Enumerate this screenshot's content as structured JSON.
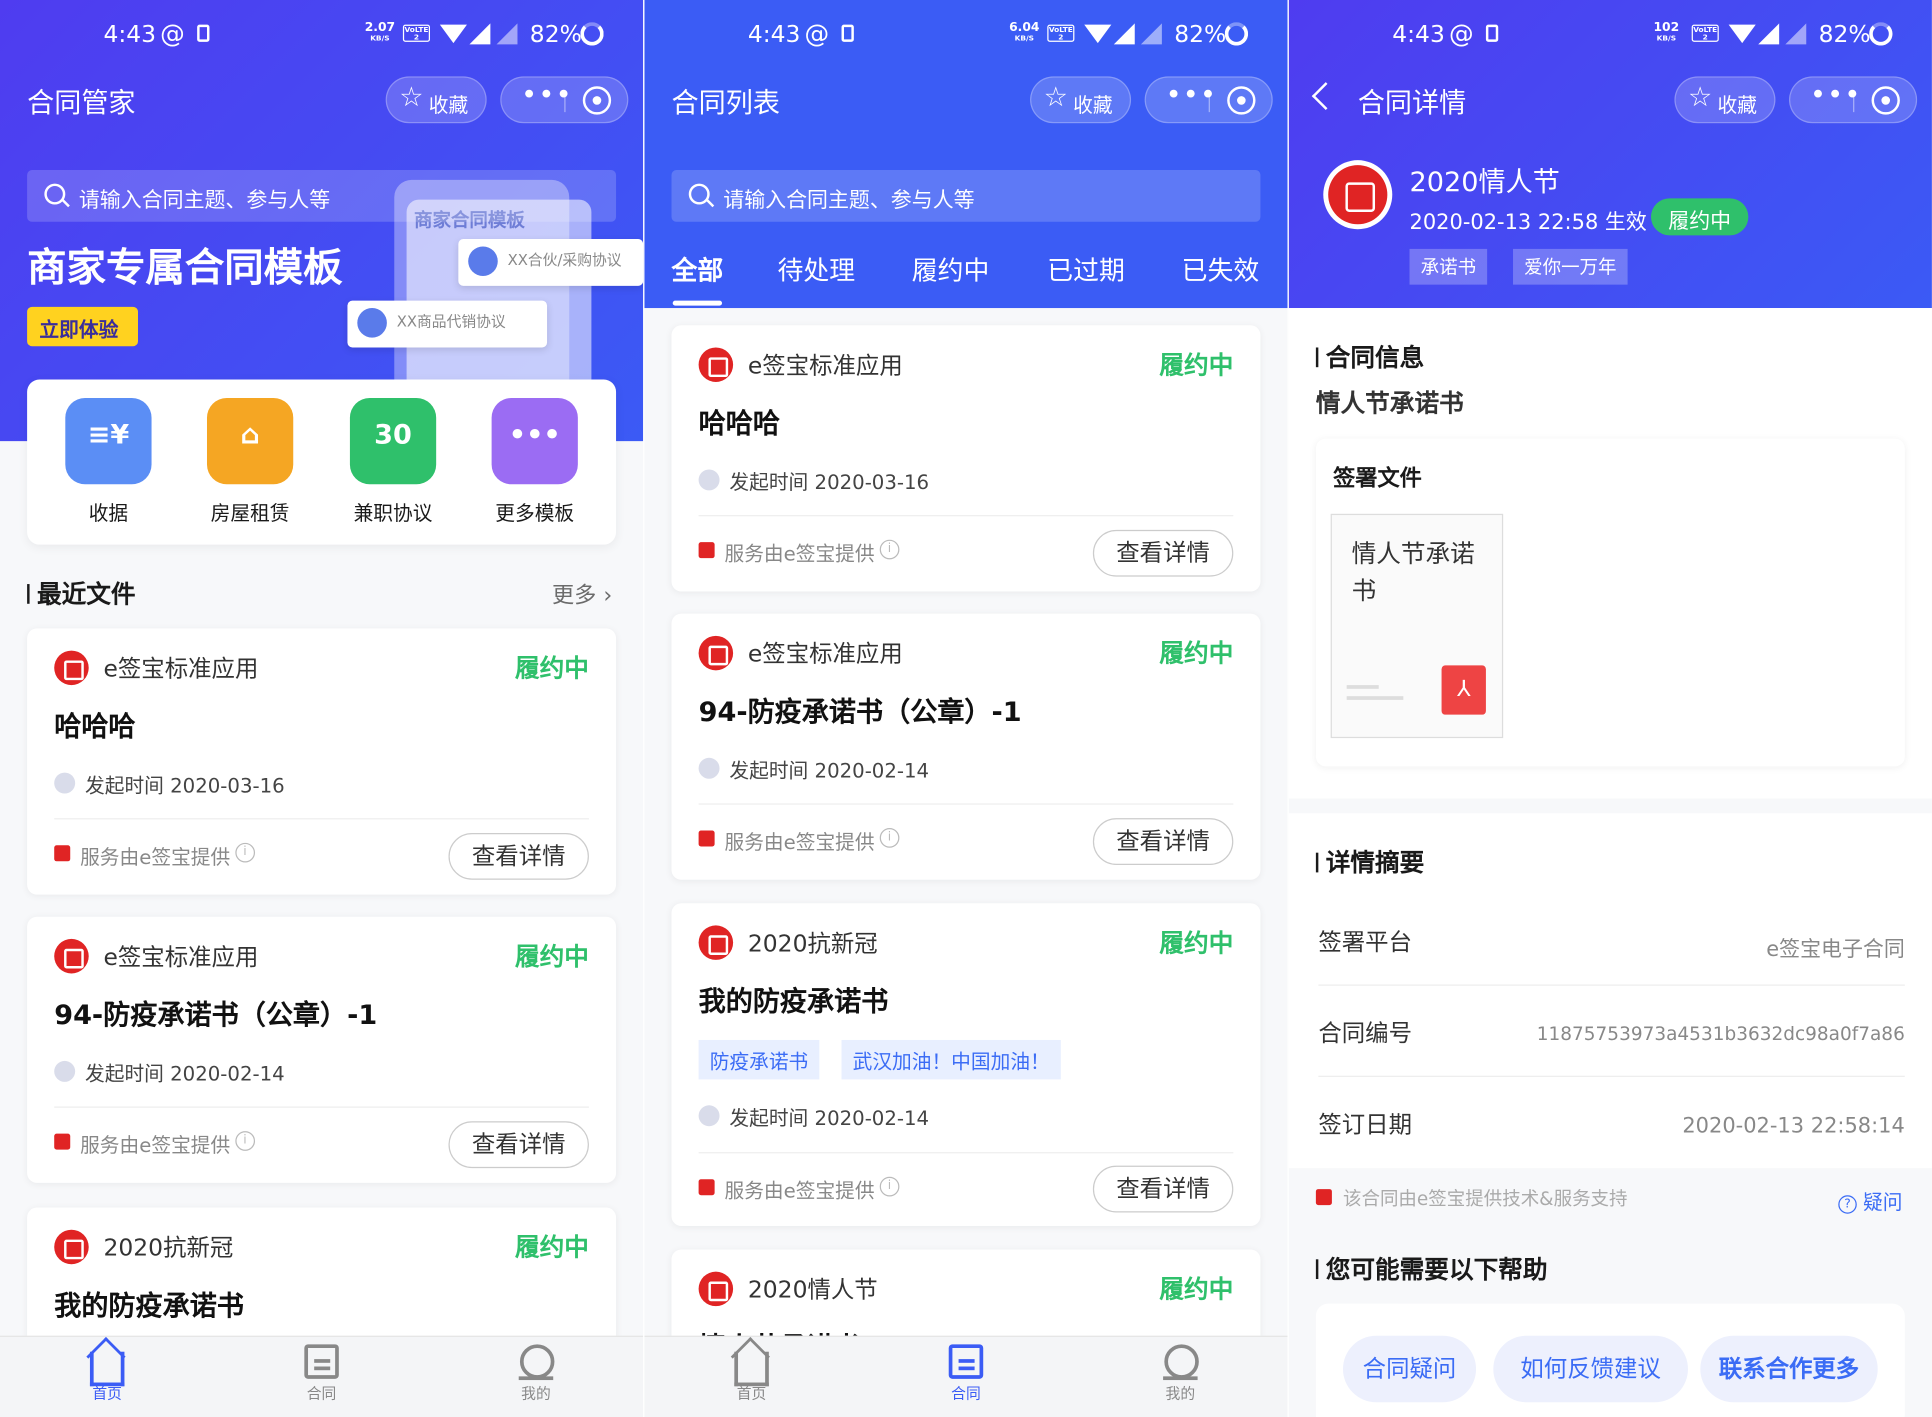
{
  "status": {
    "time": "4:43",
    "at": "@",
    "battery": "82%",
    "kbs": [
      "2.07",
      "6.04",
      "102"
    ],
    "kbs_unit": "KB/S",
    "lte": "VoLTE 2"
  },
  "nav_common": {
    "favorite": "收藏",
    "dots": "•••"
  },
  "panel1": {
    "title": "合同管家",
    "search_placeholder": "请输入合同主题、参与人等",
    "hero_title": "商家专属合同模板",
    "try_btn": "立即体验",
    "phone_title": "商家合同模板",
    "chips": [
      "XX合伙/采购协议",
      "XX商品代销协议"
    ],
    "quick": [
      {
        "label": "收据",
        "icon": "receipt-icon",
        "color": "#5b8ef5"
      },
      {
        "label": "房屋租赁",
        "icon": "house-icon",
        "color": "#f5a623"
      },
      {
        "label": "兼职协议",
        "icon": "calendar-icon",
        "color": "#2fc06b",
        "glyph": "30"
      },
      {
        "label": "更多模板",
        "icon": "folder-icon",
        "color": "#9b6cf3"
      }
    ],
    "recent_title": "最近文件",
    "more": "更多",
    "cards": [
      {
        "org": "e签宝标准应用",
        "status": "履约中",
        "name": "哈哈哈",
        "time": "发起时间 2020-03-16"
      },
      {
        "org": "e签宝标准应用",
        "status": "履约中",
        "name": "94-防疫承诺书（公章）-1",
        "time": "发起时间 2020-02-14"
      },
      {
        "org": "2020抗新冠",
        "status": "履约中",
        "name": "我的防疫承诺书",
        "time": ""
      }
    ],
    "service": "服务由e签宝提供",
    "view_btn": "查看详情"
  },
  "panel2": {
    "title": "合同列表",
    "search_placeholder": "请输入合同主题、参与人等",
    "tabs": [
      "全部",
      "待处理",
      "履约中",
      "已过期",
      "已失效"
    ],
    "cards": [
      {
        "org": "e签宝标准应用",
        "status": "履约中",
        "name": "哈哈哈",
        "time": "发起时间 2020-03-16"
      },
      {
        "org": "e签宝标准应用",
        "status": "履约中",
        "name": "94-防疫承诺书（公章）-1",
        "time": "发起时间 2020-02-14"
      },
      {
        "org": "2020抗新冠",
        "status": "履约中",
        "name": "我的防疫承诺书",
        "time": "发起时间 2020-02-14",
        "tags": [
          "防疫承诺书",
          "武汉加油！中国加油！"
        ]
      },
      {
        "org": "2020情人节",
        "status": "履约中",
        "name": "情人节承诺书",
        "time": ""
      }
    ],
    "service": "服务由e签宝提供",
    "view_btn": "查看详情"
  },
  "panel3": {
    "title": "合同详情",
    "contract_name": "2020情人节",
    "effective": "2020-02-13 22:58 生效",
    "status": "履约中",
    "tags": [
      "承诺书",
      "爱你一万年"
    ],
    "info_title": "合同信息",
    "subject": "情人节承诺书",
    "sign_files": "签署文件",
    "file_name": "情人节承诺书",
    "summary_title": "详情摘要",
    "rows": [
      {
        "k": "签署平台",
        "v": "e签宝电子合同"
      },
      {
        "k": "合同编号",
        "v": "11875753973a4531b3632dc98a0f7a86"
      },
      {
        "k": "签订日期",
        "v": "2020-02-13 22:58:14"
      }
    ],
    "support": "该合同由e签宝提供技术&服务支持",
    "question": "疑问",
    "help_title": "您可能需要以下帮助",
    "help": [
      "合同疑问",
      "如何反馈建议",
      "联系合作更多"
    ]
  },
  "bottom": [
    "首页",
    "合同",
    "我的"
  ],
  "colors": {
    "primary": "#3b5cf5",
    "green": "#2fc06b",
    "red": "#e02424"
  }
}
